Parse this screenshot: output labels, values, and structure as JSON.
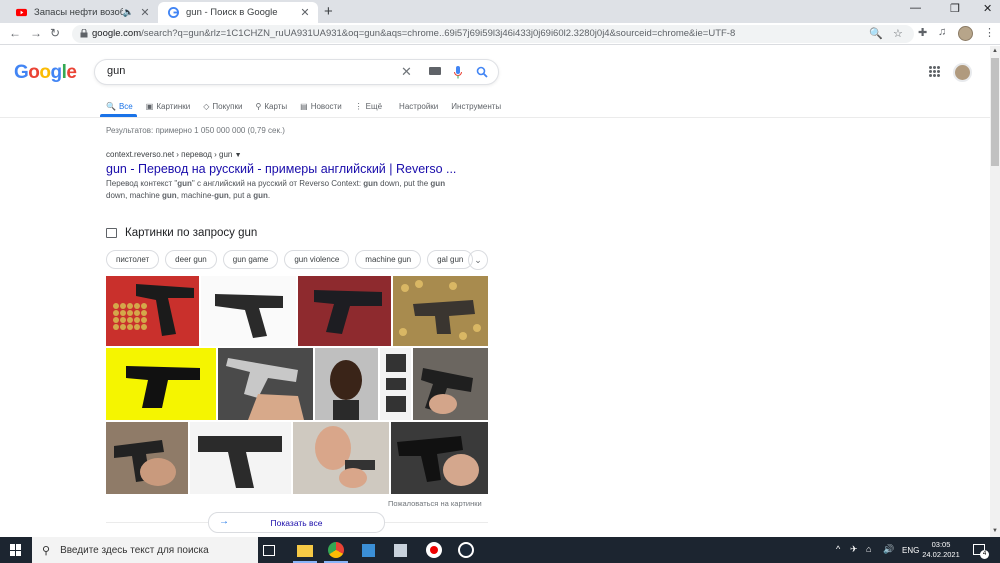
{
  "browser": {
    "tabs": [
      {
        "title": "Запасы нефти возобновляются",
        "active": false
      },
      {
        "title": "gun - Поиск в Google",
        "active": true
      }
    ],
    "url_host": "google.com",
    "url_rest": "/search?q=gun&rlz=1C1CHZN_ruUA931UA931&oq=gun&aqs=chrome..69i57j69i59l3j46i433j0j69i60l2.3280j0j4&sourceid=chrome&ie=UTF-8"
  },
  "google": {
    "logo": "Google",
    "query": "gun",
    "tabs": [
      {
        "icon": "🔍",
        "label": "Все"
      },
      {
        "icon": "▣",
        "label": "Картинки"
      },
      {
        "icon": "◇",
        "label": "Покупки"
      },
      {
        "icon": "⚲",
        "label": "Карты"
      },
      {
        "icon": "▤",
        "label": "Новости"
      },
      {
        "icon": "⋮",
        "label": "Ещё"
      },
      {
        "icon": "",
        "label": "Настройки"
      },
      {
        "icon": "",
        "label": "Инструменты"
      }
    ],
    "stats": "Результатов: примерно 1 050 000 000 (0,79 сек.)",
    "result": {
      "cite": "context.reverso.net › перевод › gun",
      "title": "gun - Перевод на русский - примеры английский | Reverso ...",
      "snippet_parts": [
        "Перевод контекст \"",
        "gun",
        "\" с английский на русский от Reverso Context: ",
        "gun",
        " down, put the ",
        "gun",
        " down, machine ",
        "gun",
        ", machine-",
        "gun",
        ", put a ",
        "gun",
        "."
      ]
    },
    "images": {
      "heading": "Картинки по запросу gun",
      "chips": [
        "пистолет",
        "deer gun",
        "gun game",
        "gun violence",
        "machine gun",
        "gal gun"
      ],
      "feedback": "Пожаловаться на картинки",
      "show_all": "Показать все"
    }
  },
  "taskbar": {
    "search_placeholder": "Введите здесь текст для поиска",
    "lang": "ENG",
    "time": "03:05",
    "date": "24.02.2021",
    "notifications": "4"
  }
}
